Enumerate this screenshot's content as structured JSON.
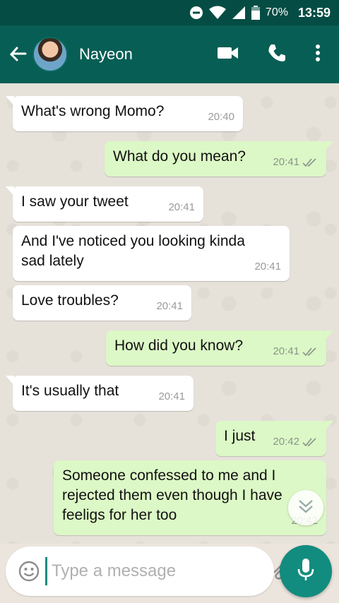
{
  "status_bar": {
    "battery": "70%",
    "time": "13:59"
  },
  "header": {
    "contact_name": "Nayeon"
  },
  "messages": [
    {
      "direction": "in",
      "text": "What's wrong Momo?",
      "time": "20:40"
    },
    {
      "direction": "out",
      "text": "What do you mean?",
      "time": "20:41"
    },
    {
      "direction": "in",
      "text": "I saw your tweet",
      "time": "20:41"
    },
    {
      "direction": "in",
      "text": "And I've noticed you looking kinda sad lately",
      "time": "20:41"
    },
    {
      "direction": "in",
      "text": "Love troubles?",
      "time": "20:41"
    },
    {
      "direction": "out",
      "text": "How did you know?",
      "time": "20:41"
    },
    {
      "direction": "in",
      "text": "It's usually that",
      "time": "20:41"
    },
    {
      "direction": "out",
      "text": "I just",
      "time": "20:42"
    },
    {
      "direction": "out",
      "text": "Someone confessed to me and I rejected them even though I have feeligs for her too",
      "time": "20:42"
    }
  ],
  "composer": {
    "placeholder": "Type a message"
  },
  "colors": {
    "header": "#075E54",
    "status_bar": "#054D44",
    "incoming_bubble": "#FFFFFF",
    "outgoing_bubble": "#DCF8C6",
    "accent": "#128C7E"
  },
  "icons": [
    "dnd-icon",
    "wifi-icon",
    "signal-icon",
    "battery-icon",
    "back-arrow-icon",
    "video-call-icon",
    "phone-icon",
    "more-vert-icon",
    "double-check-icon",
    "scroll-down-icon",
    "emoji-icon",
    "attach-icon",
    "camera-icon",
    "mic-icon"
  ]
}
